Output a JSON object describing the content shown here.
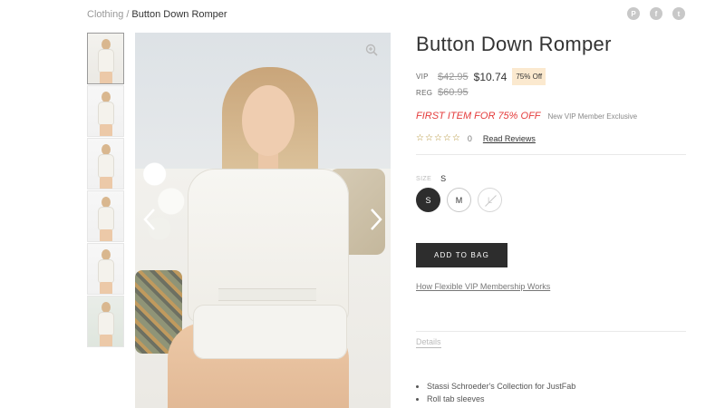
{
  "breadcrumb": {
    "parent": "Clothing",
    "separator": "/",
    "current": "Button Down Romper"
  },
  "social": [
    {
      "name": "pinterest-icon",
      "glyph": "P"
    },
    {
      "name": "facebook-icon",
      "glyph": "f"
    },
    {
      "name": "twitter-icon",
      "glyph": "t"
    }
  ],
  "product": {
    "title": "Button Down Romper",
    "vip_label": "VIP",
    "vip_old_price": "$42.95",
    "vip_price": "$10.74",
    "off_badge": "75% Off",
    "reg_label": "REG",
    "reg_price": "$60.95",
    "promo_main": "FIRST ITEM FOR 75% OFF",
    "promo_sub": "New VIP Member Exclusive",
    "rating": 0,
    "review_count": "0",
    "read_reviews": "Read Reviews"
  },
  "size": {
    "label": "SIZE",
    "selected": "S",
    "options": [
      {
        "label": "S",
        "state": "selected"
      },
      {
        "label": "M",
        "state": "available"
      },
      {
        "label": "L",
        "state": "out-of-stock"
      }
    ]
  },
  "actions": {
    "add_to_bag": "ADD TO BAG",
    "vip_link": "How Flexible VIP Membership Works"
  },
  "details": {
    "tab_label": "Details",
    "bullets": [
      "Stassi Schroeder's Collection for JustFab",
      "Roll tab sleeves"
    ]
  },
  "colors": {
    "promo_red": "#e43b3b",
    "button_dark": "#2d2d2d",
    "badge_bg": "#fbe9cf",
    "star_gold": "#b08d2c"
  }
}
